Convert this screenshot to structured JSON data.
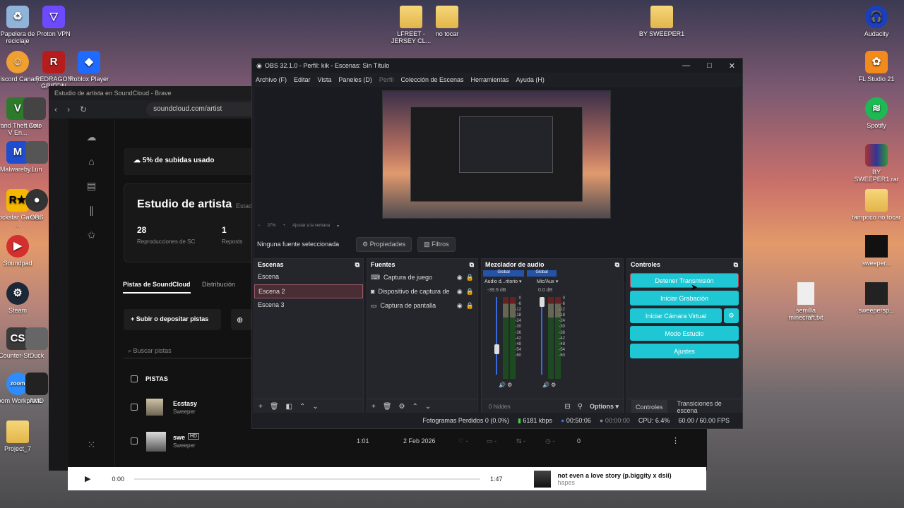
{
  "desktop": {
    "left_icons": [
      "Papelera de reciclaje",
      "Proton VPN",
      "Discord Canary",
      "REDRAGON GRIFFIN",
      "Roblox Player",
      "Grand Theft Auto V En...",
      "Cou",
      "Malwareby...",
      "Lun",
      "Rockstar Games ...",
      "OBS",
      "Soundpad",
      "Steam",
      "Counter-Str...",
      "Duck",
      "Zoom Workplace",
      "AMD",
      "Project_7"
    ],
    "top_icons": [
      "LFREET - JERSEY CL...",
      "no tocar",
      "BY SWEEPER1"
    ],
    "right_icons": [
      "Audacity",
      "FL Studio 21",
      "Spotify",
      "BY SWEEPER1.rar",
      "tampoco no tocar",
      "sweeper...",
      "semilla minecraft.txt",
      "sweepersp..."
    ]
  },
  "brave": {
    "title": "Estudio de artista en SoundCloud - Brave",
    "url": "soundcloud.com/artist",
    "uploads": "5% de subidas usado",
    "studio_title": "Estudio de artista",
    "studio_sub": "Estad",
    "plays_value": "28",
    "plays_label": "Reproducciones de SC",
    "reposts_value": "1",
    "reposts_label": "Reposts",
    "tab1": "Pistas de SoundCloud",
    "tab2": "Distribución",
    "upload_btn": "Subir o depositar pistas",
    "search_placeholder": "Buscar pistas",
    "tracks_header": "PISTAS",
    "tracks": [
      {
        "title": "Ecstasy",
        "artist": "Sweeper",
        "badge": ""
      },
      {
        "title": "swe",
        "artist": "Sweeper",
        "badge": "HD",
        "duration": "1:01",
        "date": "2 Feb 2026",
        "plays": "0"
      }
    ]
  },
  "player": {
    "time": "0:00",
    "duration": "1:47",
    "track": "not even a love story (p.biggity x dsii)",
    "artist": "hapes"
  },
  "obs": {
    "title": "OBS 32.1.0 - Perfil: kik - Escenas: Sin Título",
    "menu": [
      "Archivo (F)",
      "Editar",
      "Vista",
      "Paneles (D)",
      "Perfil",
      "Colección de Escenas",
      "Herramientas",
      "Ayuda (H)"
    ],
    "zoom": "37%",
    "fit": "Ajustar a la ventana",
    "no_source": "Ninguna fuente seleccionada",
    "props_btn": "Propiedades",
    "filters_btn": "Filtros",
    "scenes_title": "Escenas",
    "scenes": [
      "Escena",
      "Escena 2",
      "Escena 3"
    ],
    "sources_title": "Fuentes",
    "sources": [
      "Captura de juego",
      "Dispositivo de captura de",
      "Captura de pantalla"
    ],
    "mixer_title": "Mezclador de audio",
    "mixer": [
      {
        "group": "Global",
        "name": "Audio d...ritorio",
        "db": "-39.9 dB",
        "level": 0.3
      },
      {
        "group": "Global",
        "name": "Mic/Aux",
        "db": "0.0 dB",
        "level": 1.0
      }
    ],
    "scale": [
      "0",
      "-6",
      "-12",
      "-18",
      "-24",
      "-30",
      "-36",
      "-42",
      "-48",
      "-54",
      "-60"
    ],
    "hidden": "0 hidden",
    "options": "Options",
    "controls_title": "Controles",
    "controls": [
      "Detener Transmisión",
      "Iniciar Grabación",
      "Iniciar Cámara Virtual",
      "Modo Estudio",
      "Ajustes"
    ],
    "bottom_tabs": [
      "Controles",
      "Transiciones de escena"
    ],
    "status": {
      "dropped": "Fotogramas Perdidos 0 (0.0%)",
      "kbps": "6181 kbps",
      "stream_time": "00:50:06",
      "rec_time": "00:00:00",
      "cpu": "CPU: 6.4%",
      "fps": "60.00 / 60.00 FPS"
    }
  }
}
